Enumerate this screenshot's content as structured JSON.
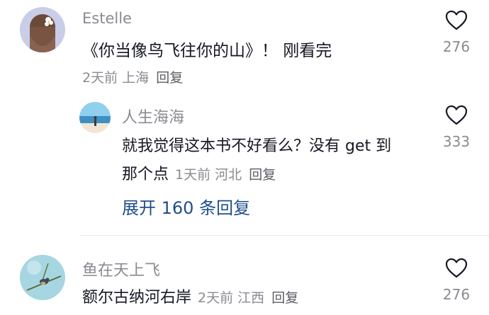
{
  "comments": [
    {
      "username": "Estelle",
      "content": "《你当像鸟飞往你的山》！ 刚看完",
      "time": "2天前",
      "location": "上海",
      "reply_label": "回复",
      "like_count": "276",
      "avatar": "girl-with-flower-avatar",
      "replies": [
        {
          "username": "人生海海",
          "content_line1": "就我觉得这本书不好看么？没有 get 到",
          "content_line2": "那个点",
          "time": "1天前",
          "location": "河北",
          "reply_label": "回复",
          "like_count": "333",
          "avatar": "beach-avatar"
        }
      ],
      "expand_label": "展开 160 条回复"
    },
    {
      "username": "鱼在天上飞",
      "content": "额尔古纳河右岸",
      "time": "2天前",
      "location": "江西",
      "reply_label": "回复",
      "like_count": "276",
      "avatar": "bird-on-branch-avatar"
    }
  ],
  "colors": {
    "text_primary": "#161823",
    "text_secondary": "#8a8b91",
    "link": "#1f4e8c",
    "divider": "#e9e9ea"
  }
}
